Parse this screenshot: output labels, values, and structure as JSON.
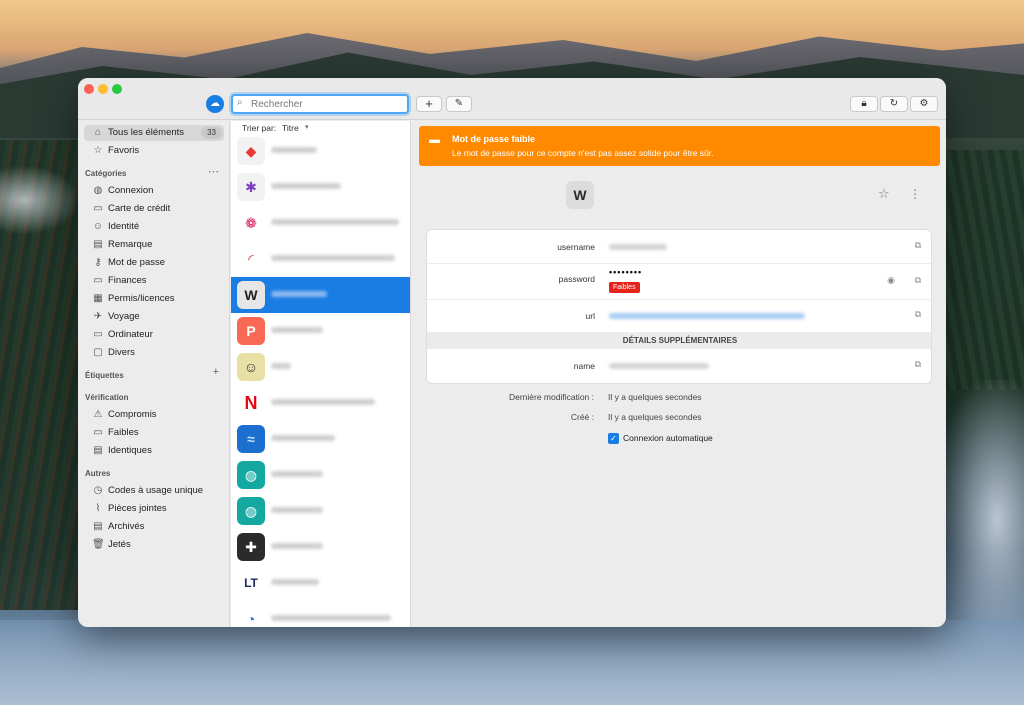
{
  "toolbar": {
    "search_placeholder": "Rechercher",
    "add_label": "+",
    "edit_icon": "pencil-icon",
    "lock_icon": "lock-icon",
    "sync_icon": "sync-icon",
    "settings_icon": "gear-icon"
  },
  "sidebar": {
    "all_items": {
      "label": "Tous les éléments",
      "count": "33"
    },
    "favorites": {
      "label": "Favoris"
    },
    "categories_heading": "Catégories",
    "categories": [
      {
        "label": "Connexion",
        "icon": "globe-icon"
      },
      {
        "label": "Carte de crédit",
        "icon": "credit-card-icon"
      },
      {
        "label": "Identité",
        "icon": "identity-icon"
      },
      {
        "label": "Remarque",
        "icon": "note-icon"
      },
      {
        "label": "Mot de passe",
        "icon": "key-icon"
      },
      {
        "label": "Finances",
        "icon": "finance-icon"
      },
      {
        "label": "Permis/licences",
        "icon": "license-icon"
      },
      {
        "label": "Voyage",
        "icon": "plane-icon"
      },
      {
        "label": "Ordinateur",
        "icon": "computer-icon"
      },
      {
        "label": "Divers",
        "icon": "misc-icon"
      }
    ],
    "tags_heading": "Étiquettes",
    "verification_heading": "Vérification",
    "verification": [
      {
        "label": "Compromis",
        "icon": "warning-icon"
      },
      {
        "label": "Faibles",
        "icon": "weak-icon"
      },
      {
        "label": "Identiques",
        "icon": "duplicate-icon"
      }
    ],
    "others_heading": "Autres",
    "others": [
      {
        "label": "Codes à usage unique",
        "icon": "clock-icon"
      },
      {
        "label": "Pièces jointes",
        "icon": "paperclip-icon"
      },
      {
        "label": "Archivés",
        "icon": "archive-icon"
      },
      {
        "label": "Jetés",
        "icon": "trash-icon"
      }
    ]
  },
  "list": {
    "sort_label": "Trier par:",
    "sort_value": "Titre",
    "items": [
      {
        "logo": "pdf-logo",
        "color": "#f2f2f2"
      },
      {
        "logo": "pinwheel-logo",
        "color": "#f2f2f2"
      },
      {
        "logo": "mandala-logo",
        "color": "#ffffff"
      },
      {
        "logo": "swoosh-logo",
        "color": "#ffffff"
      },
      {
        "logo": "w-logo",
        "color": "#e6e6e6",
        "selected": true
      },
      {
        "logo": "patreon-logo",
        "color": "#f96854"
      },
      {
        "logo": "sticker-logo",
        "color": "#e9e0a6"
      },
      {
        "logo": "netflix-logo",
        "color": "#ffffff"
      },
      {
        "logo": "wave-logo",
        "color": "#1b6fcf"
      },
      {
        "logo": "globe-logo",
        "color": "#14a8a0"
      },
      {
        "logo": "globe-logo",
        "color": "#14a8a0"
      },
      {
        "logo": "plus-logo",
        "color": "#2b2b2b"
      },
      {
        "logo": "lt-logo",
        "color": "#ffffff"
      },
      {
        "logo": "bouygues-logo",
        "color": "#ffffff"
      }
    ]
  },
  "detail": {
    "alert_title": "Mot de passe faible",
    "alert_text": "Le mot de passe pour ce compte n'est pas assez solide pour être sûr.",
    "fields": {
      "username_label": "username",
      "password_label": "password",
      "password_mask": "••••••••",
      "weak_badge": "Faibles",
      "url_label": "url",
      "section_heading": "DÉTAILS SUPPLÉMENTAIRES",
      "name_label": "name"
    },
    "meta": {
      "modified_label": "Dernière modification :",
      "modified_value": "Il y a quelques secondes",
      "created_label": "Créé :",
      "created_value": "Il y a quelques secondes",
      "autologin_label": "Connexion automatique"
    }
  }
}
